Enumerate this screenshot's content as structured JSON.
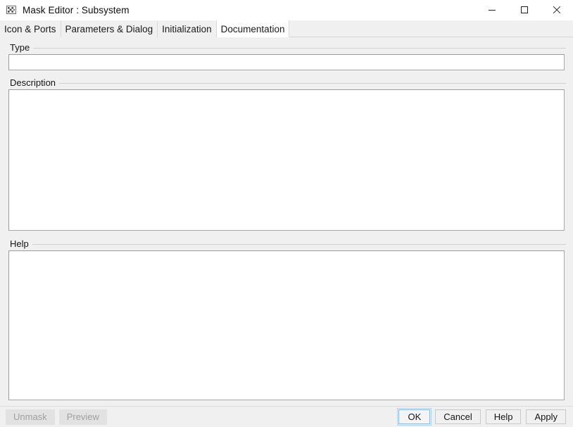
{
  "window": {
    "title": "Mask Editor : Subsystem",
    "icon": "mask-editor-icon",
    "controls": {
      "minimize": "minimize-icon",
      "maximize": "maximize-icon",
      "close": "close-icon"
    }
  },
  "tabs": [
    {
      "id": "icon-ports",
      "label": "Icon & Ports",
      "active": false
    },
    {
      "id": "parameters-dialog",
      "label": "Parameters & Dialog",
      "active": false
    },
    {
      "id": "initialization",
      "label": "Initialization",
      "active": false
    },
    {
      "id": "documentation",
      "label": "Documentation",
      "active": true
    }
  ],
  "documentation": {
    "type": {
      "label": "Type",
      "value": "",
      "placeholder": ""
    },
    "description": {
      "label": "Description",
      "value": "",
      "placeholder": ""
    },
    "help": {
      "label": "Help",
      "value": "",
      "placeholder": ""
    }
  },
  "footer": {
    "left_buttons": [
      {
        "id": "unmask",
        "label": "Unmask",
        "enabled": false
      },
      {
        "id": "preview",
        "label": "Preview",
        "enabled": false
      }
    ],
    "right_buttons": [
      {
        "id": "ok",
        "label": "OK",
        "default": true
      },
      {
        "id": "cancel",
        "label": "Cancel",
        "default": false
      },
      {
        "id": "help",
        "label": "Help",
        "default": false
      },
      {
        "id": "apply",
        "label": "Apply",
        "default": false
      }
    ]
  },
  "colors": {
    "window_background": "#f0f0f0",
    "titlebar_background": "#ffffff",
    "active_tab_background": "#ffffff",
    "field_background": "#ffffff",
    "field_border": "#a8a8a8",
    "default_button_focus": "#8fb9d9",
    "disabled_text": "#a0a0a0"
  }
}
